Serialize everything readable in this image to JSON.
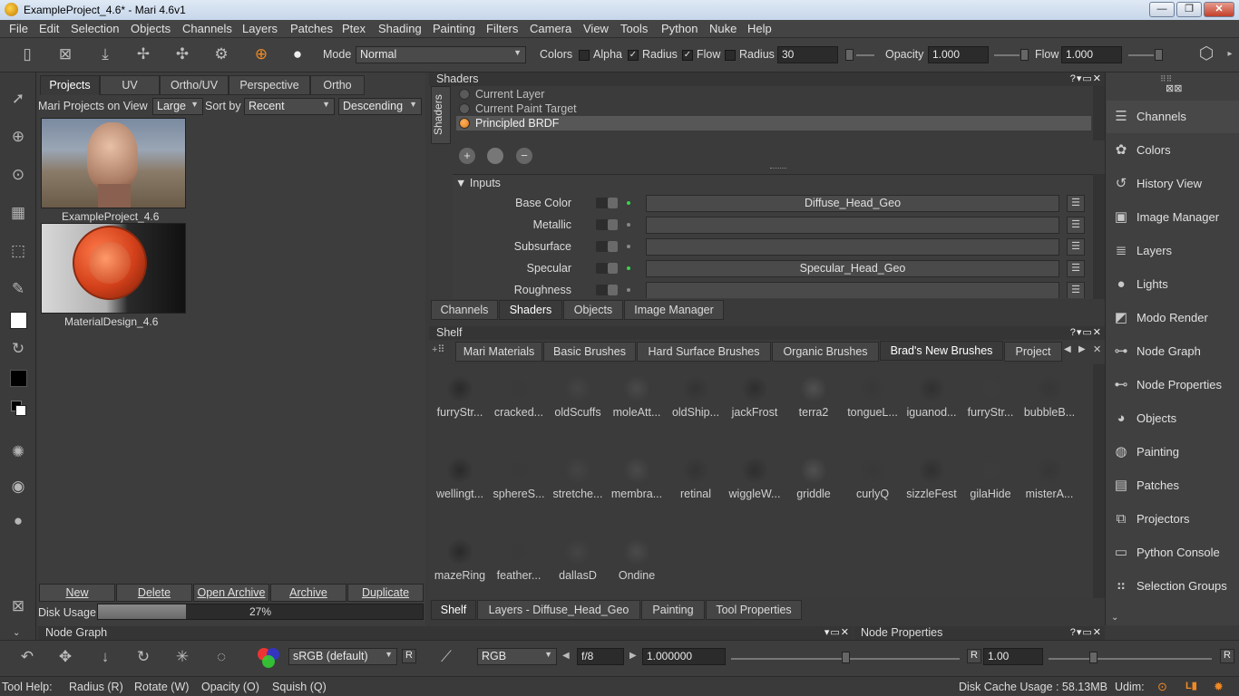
{
  "window": {
    "title": "ExampleProject_4.6* - Mari 4.6v1"
  },
  "menu": [
    "File",
    "Edit",
    "Selection",
    "Objects",
    "Channels",
    "Layers",
    "Patches",
    "Ptex",
    "Shading",
    "Painting",
    "Filters",
    "Camera",
    "View",
    "Tools",
    "Python",
    "Nuke",
    "Help"
  ],
  "toolbar": {
    "mode_label": "Mode",
    "mode_value": "Normal",
    "colors_label": "Colors",
    "alpha_label": "Alpha",
    "radius_label": "Radius",
    "flow_label": "Flow",
    "radius2_label": "Radius",
    "radius2_value": "30",
    "opacity_label": "Opacity",
    "opacity_value": "1.000",
    "flow2_label": "Flow",
    "flow2_value": "1.000"
  },
  "projects": {
    "tabs": [
      "Projects",
      "UV",
      "Ortho/UV",
      "Perspective",
      "Ortho"
    ],
    "on_view_label": "Mari Projects on View",
    "size_value": "Large",
    "sort_label": "Sort by",
    "sort_value": "Recent",
    "order_value": "Descending",
    "items": [
      {
        "name": "ExampleProject_4.6"
      },
      {
        "name": "MaterialDesign_4.6"
      }
    ],
    "buttons": [
      "New",
      "Delete",
      "Open Archive",
      "Archive",
      "Duplicate"
    ],
    "disk_usage_label": "Disk Usage",
    "disk_usage_value": "27%",
    "disk_usage_fraction": 0.27
  },
  "shaders": {
    "title": "Shaders",
    "side_tab": "Shaders",
    "list": [
      "Current Layer",
      "Current Paint Target",
      "Principled BRDF"
    ],
    "inputs_label": "Inputs",
    "inputs": [
      {
        "name": "Base Color",
        "map": "Diffuse_Head_Geo",
        "connected": true
      },
      {
        "name": "Metallic",
        "map": "",
        "connected": false
      },
      {
        "name": "Subsurface",
        "map": "",
        "connected": false
      },
      {
        "name": "Specular",
        "map": "Specular_Head_Geo",
        "connected": true
      },
      {
        "name": "Roughness",
        "map": "",
        "connected": false
      }
    ],
    "bottom_tabs": [
      "Channels",
      "Shaders",
      "Objects",
      "Image Manager"
    ]
  },
  "shelf": {
    "title": "Shelf",
    "tabs": [
      "Mari Materials",
      "Basic Brushes",
      "Hard Surface Brushes",
      "Organic Brushes",
      "Brad's New Brushes",
      "Project"
    ],
    "brushes": [
      "furryStr...",
      "cracked...",
      "oldScuffs",
      "moleAtt...",
      "oldShip...",
      "jackFrost",
      "terra2",
      "tongueL...",
      "iguanod...",
      "furryStr...",
      "bubbleB...",
      "wellingt...",
      "sphereS...",
      "stretche...",
      "membra...",
      "retinal",
      "wiggleW...",
      "griddle",
      "curlyQ",
      "sizzleFest",
      "gilaHide",
      "misterA...",
      "mazeRing",
      "feather...",
      "dallasD",
      "Ondine"
    ],
    "bottom_tabs": [
      "Shelf",
      "Layers - Diffuse_Head_Geo",
      "Painting",
      "Tool Properties"
    ]
  },
  "right_palettes": [
    "Channels",
    "Colors",
    "History View",
    "Image Manager",
    "Layers",
    "Lights",
    "Modo Render",
    "Node Graph",
    "Node Properties",
    "Objects",
    "Painting",
    "Patches",
    "Projectors",
    "Python Console",
    "Selection Groups"
  ],
  "lower_panels": {
    "node_graph": "Node Graph",
    "node_properties": "Node Properties"
  },
  "bottom_toolbar": {
    "colorspace": "sRGB (default)",
    "r_btn": "R",
    "channel": "RGB",
    "fstop": "f/8",
    "exposure": "1.000000",
    "r_btn2": "R",
    "gamma": "1.00",
    "r_btn3": "R"
  },
  "status": {
    "tool_help": "Tool Help:",
    "hints": [
      "Radius (R)",
      "Rotate (W)",
      "Opacity (O)",
      "Squish (Q)"
    ],
    "disk_cache": "Disk Cache Usage : 58.13MB",
    "udim": "Udim:"
  }
}
